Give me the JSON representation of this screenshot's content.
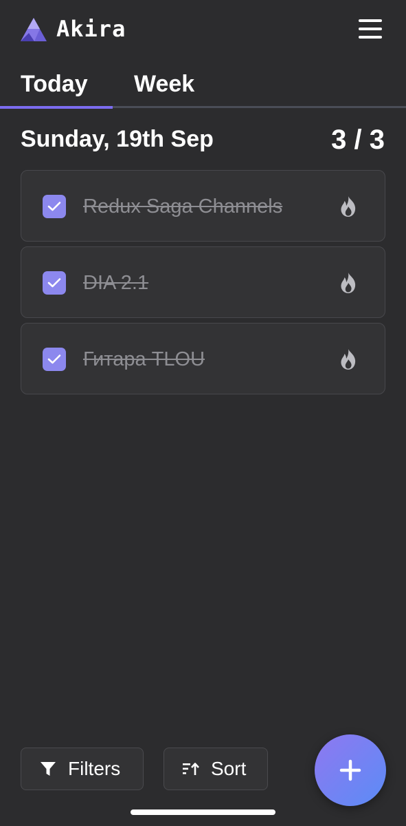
{
  "header": {
    "app_name": "Akira",
    "logo_icon": "akira-logo",
    "menu_icon": "hamburger-menu-icon"
  },
  "tabs": [
    {
      "label": "Today",
      "active": true
    },
    {
      "label": "Week",
      "active": false
    }
  ],
  "day": {
    "date": "Sunday, 19th Sep",
    "progress": "3 / 3"
  },
  "tasks": [
    {
      "title": "Redux Saga Channels",
      "done": true,
      "icon": "fire-icon"
    },
    {
      "title": "DIA 2.1",
      "done": true,
      "icon": "fire-icon"
    },
    {
      "title": "Гитара TLOU",
      "done": true,
      "icon": "fire-icon"
    }
  ],
  "toolbar": {
    "filters_label": "Filters",
    "filters_icon": "funnel-icon",
    "sort_label": "Sort",
    "sort_icon": "sort-icon",
    "add_icon": "plus-icon"
  },
  "colors": {
    "background": "#2c2c2e",
    "accent": "#7c6cf0",
    "checkbox": "#8c88ee",
    "fab_gradient_start": "#8f78f0",
    "fab_gradient_end": "#5b8cf6"
  }
}
